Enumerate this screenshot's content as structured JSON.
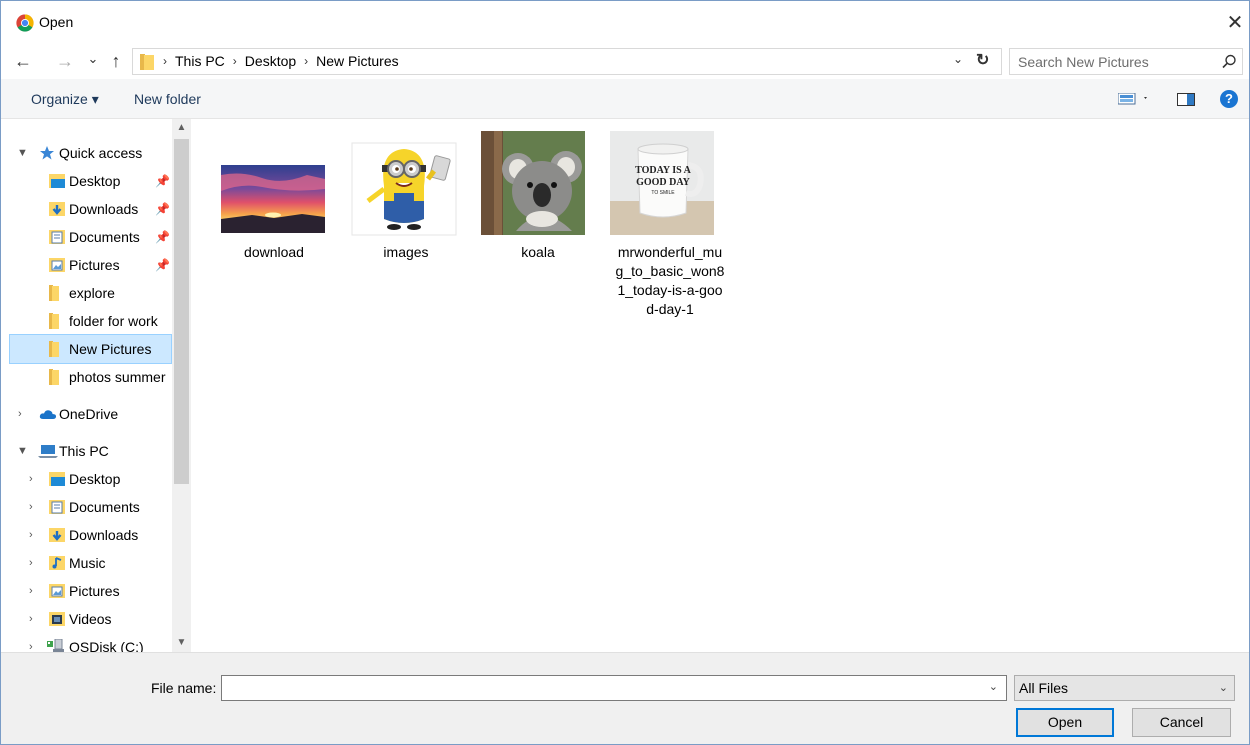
{
  "window": {
    "title": "Open",
    "close_glyph": "✕",
    "icon": "chrome-icon"
  },
  "nav": {
    "back_glyph": "←",
    "forward_glyph": "→",
    "recent_glyph": "⌄",
    "up_glyph": "↑",
    "breadcrumb": [
      "This PC",
      "Desktop",
      "New Pictures"
    ],
    "separator": "›",
    "search_placeholder": "Search New Pictures"
  },
  "toolbar": {
    "organize_label": "Organize ▾",
    "new_folder_label": "New folder",
    "help_glyph": "?"
  },
  "sidebar": {
    "quick_access": {
      "label": "Quick access",
      "items": [
        {
          "label": "Desktop",
          "pinned": true,
          "icon": "desktop-folder-icon"
        },
        {
          "label": "Downloads",
          "pinned": true,
          "icon": "downloads-folder-icon"
        },
        {
          "label": "Documents",
          "pinned": true,
          "icon": "documents-folder-icon"
        },
        {
          "label": "Pictures",
          "pinned": true,
          "icon": "pictures-folder-icon"
        },
        {
          "label": "explore",
          "pinned": false,
          "icon": "folder-icon"
        },
        {
          "label": "folder for work",
          "pinned": false,
          "icon": "folder-icon"
        },
        {
          "label": "New Pictures",
          "pinned": false,
          "icon": "folder-icon",
          "selected": true
        },
        {
          "label": "photos summer",
          "pinned": false,
          "icon": "folder-icon"
        }
      ]
    },
    "onedrive": {
      "label": "OneDrive"
    },
    "this_pc": {
      "label": "This PC",
      "items": [
        {
          "label": "Desktop",
          "icon": "desktop-folder-icon"
        },
        {
          "label": "Documents",
          "icon": "documents-folder-icon"
        },
        {
          "label": "Downloads",
          "icon": "downloads-folder-icon"
        },
        {
          "label": "Music",
          "icon": "music-folder-icon"
        },
        {
          "label": "Pictures",
          "icon": "pictures-folder-icon"
        },
        {
          "label": "Videos",
          "icon": "videos-folder-icon"
        },
        {
          "label": "OSDisk (C:)",
          "icon": "drive-icon"
        }
      ]
    }
  },
  "files": [
    {
      "name": "download",
      "thumb": "sunset-thumbnail"
    },
    {
      "name": "images",
      "thumb": "minion-thumbnail"
    },
    {
      "name": "koala",
      "thumb": "koala-thumbnail"
    },
    {
      "name": "mrwonderful_mug_to_basic_won81_today-is-a-good-day-1",
      "name_lines": [
        "mrwonderful_mu",
        "g_to_basic_won8",
        "1_today-is-a-goo",
        "d-day-1"
      ],
      "thumb": "mug-thumbnail",
      "mug_text": [
        "TODAY IS A",
        "GOOD DAY",
        "TO SMILE"
      ]
    }
  ],
  "footer": {
    "file_name_label": "File name:",
    "file_name_value": "",
    "filter_value": "All Files",
    "open_label": "Open",
    "cancel_label": "Cancel"
  }
}
